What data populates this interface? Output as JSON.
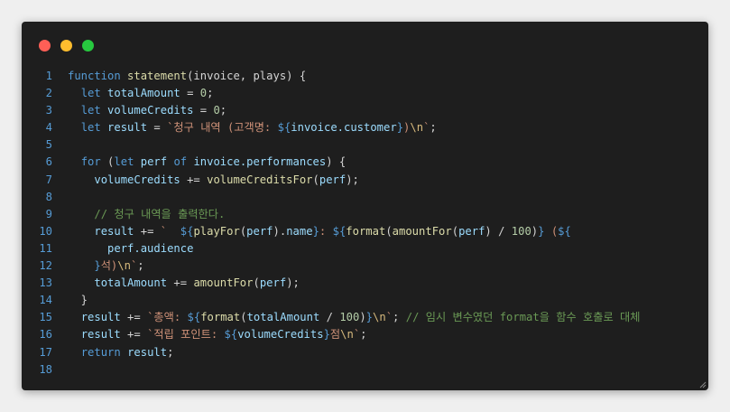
{
  "window": {
    "bg": "#1e1e1e",
    "controls": [
      {
        "name": "close",
        "color": "#ff5f56"
      },
      {
        "name": "minimize",
        "color": "#ffbd2e"
      },
      {
        "name": "maximize",
        "color": "#27c93f"
      }
    ]
  },
  "colors": {
    "keyword": "#569cd6",
    "function": "#dcdcaa",
    "variable": "#9cdcfe",
    "string": "#ce9178",
    "number": "#b5cea8",
    "comment": "#6a9955",
    "plain": "#d4d4d4",
    "interp": "#569cd6",
    "escape": "#d7ba7d"
  },
  "code": {
    "lines": [
      {
        "n": "1",
        "tokens": [
          [
            "keyword",
            "function "
          ],
          [
            "function",
            "statement"
          ],
          [
            "plain",
            "(invoice, plays) {"
          ]
        ]
      },
      {
        "n": "2",
        "tokens": [
          [
            "plain",
            "  "
          ],
          [
            "keyword",
            "let "
          ],
          [
            "variable",
            "totalAmount"
          ],
          [
            "plain",
            " = "
          ],
          [
            "number",
            "0"
          ],
          [
            "plain",
            ";"
          ]
        ]
      },
      {
        "n": "3",
        "tokens": [
          [
            "plain",
            "  "
          ],
          [
            "keyword",
            "let "
          ],
          [
            "variable",
            "volumeCredits"
          ],
          [
            "plain",
            " = "
          ],
          [
            "number",
            "0"
          ],
          [
            "plain",
            ";"
          ]
        ]
      },
      {
        "n": "4",
        "tokens": [
          [
            "plain",
            "  "
          ],
          [
            "keyword",
            "let "
          ],
          [
            "variable",
            "result"
          ],
          [
            "plain",
            " = "
          ],
          [
            "string",
            "`청구 내역 (고객명: "
          ],
          [
            "interp",
            "${"
          ],
          [
            "variable",
            "invoice.customer"
          ],
          [
            "interp",
            "}"
          ],
          [
            "string",
            ")"
          ],
          [
            "escape",
            "\\n"
          ],
          [
            "string",
            "`"
          ],
          [
            "plain",
            ";"
          ]
        ]
      },
      {
        "n": "5",
        "tokens": []
      },
      {
        "n": "6",
        "tokens": [
          [
            "plain",
            "  "
          ],
          [
            "keyword",
            "for "
          ],
          [
            "plain",
            "("
          ],
          [
            "keyword",
            "let "
          ],
          [
            "variable",
            "perf "
          ],
          [
            "keyword",
            "of "
          ],
          [
            "variable",
            "invoice.performances"
          ],
          [
            "plain",
            ") {"
          ]
        ]
      },
      {
        "n": "7",
        "tokens": [
          [
            "plain",
            "    "
          ],
          [
            "variable",
            "volumeCredits"
          ],
          [
            "plain",
            " += "
          ],
          [
            "function",
            "volumeCreditsFor"
          ],
          [
            "plain",
            "("
          ],
          [
            "variable",
            "perf"
          ],
          [
            "plain",
            ");"
          ]
        ]
      },
      {
        "n": "8",
        "tokens": []
      },
      {
        "n": "9",
        "tokens": [
          [
            "plain",
            "    "
          ],
          [
            "comment",
            "// 청구 내역을 출력한다."
          ]
        ]
      },
      {
        "n": "10",
        "tokens": [
          [
            "plain",
            "    "
          ],
          [
            "variable",
            "result"
          ],
          [
            "plain",
            " += "
          ],
          [
            "string",
            "`  "
          ],
          [
            "interp",
            "${"
          ],
          [
            "function",
            "playFor"
          ],
          [
            "plain",
            "("
          ],
          [
            "variable",
            "perf"
          ],
          [
            "plain",
            ")."
          ],
          [
            "variable",
            "name"
          ],
          [
            "interp",
            "}"
          ],
          [
            "string",
            ": "
          ],
          [
            "interp",
            "${"
          ],
          [
            "function",
            "format"
          ],
          [
            "plain",
            "("
          ],
          [
            "function",
            "amountFor"
          ],
          [
            "plain",
            "("
          ],
          [
            "variable",
            "perf"
          ],
          [
            "plain",
            ") / "
          ],
          [
            "number",
            "100"
          ],
          [
            "plain",
            ")"
          ],
          [
            "interp",
            "}"
          ],
          [
            "string",
            " ("
          ],
          [
            "interp",
            "${"
          ]
        ]
      },
      {
        "n": "11",
        "tokens": [
          [
            "plain",
            "      "
          ],
          [
            "variable",
            "perf.audience"
          ]
        ]
      },
      {
        "n": "12",
        "tokens": [
          [
            "plain",
            "    "
          ],
          [
            "interp",
            "}"
          ],
          [
            "string",
            "석)"
          ],
          [
            "escape",
            "\\n"
          ],
          [
            "string",
            "`"
          ],
          [
            "plain",
            ";"
          ]
        ]
      },
      {
        "n": "13",
        "tokens": [
          [
            "plain",
            "    "
          ],
          [
            "variable",
            "totalAmount"
          ],
          [
            "plain",
            " += "
          ],
          [
            "function",
            "amountFor"
          ],
          [
            "plain",
            "("
          ],
          [
            "variable",
            "perf"
          ],
          [
            "plain",
            ");"
          ]
        ]
      },
      {
        "n": "14",
        "tokens": [
          [
            "plain",
            "  }"
          ]
        ]
      },
      {
        "n": "15",
        "tokens": [
          [
            "plain",
            "  "
          ],
          [
            "variable",
            "result"
          ],
          [
            "plain",
            " += "
          ],
          [
            "string",
            "`총액: "
          ],
          [
            "interp",
            "${"
          ],
          [
            "function",
            "format"
          ],
          [
            "plain",
            "("
          ],
          [
            "variable",
            "totalAmount"
          ],
          [
            "plain",
            " / "
          ],
          [
            "number",
            "100"
          ],
          [
            "plain",
            ")"
          ],
          [
            "interp",
            "}"
          ],
          [
            "escape",
            "\\n"
          ],
          [
            "string",
            "`"
          ],
          [
            "plain",
            "; "
          ],
          [
            "comment",
            "// 임시 변수였던 format을 함수 호출로 대체"
          ]
        ]
      },
      {
        "n": "16",
        "tokens": [
          [
            "plain",
            "  "
          ],
          [
            "variable",
            "result"
          ],
          [
            "plain",
            " += "
          ],
          [
            "string",
            "`적립 포인트: "
          ],
          [
            "interp",
            "${"
          ],
          [
            "variable",
            "volumeCredits"
          ],
          [
            "interp",
            "}"
          ],
          [
            "string",
            "점"
          ],
          [
            "escape",
            "\\n"
          ],
          [
            "string",
            "`"
          ],
          [
            "plain",
            ";"
          ]
        ]
      },
      {
        "n": "17",
        "tokens": [
          [
            "plain",
            "  "
          ],
          [
            "keyword",
            "return "
          ],
          [
            "variable",
            "result"
          ],
          [
            "plain",
            ";"
          ]
        ]
      },
      {
        "n": "18",
        "tokens": []
      }
    ]
  }
}
